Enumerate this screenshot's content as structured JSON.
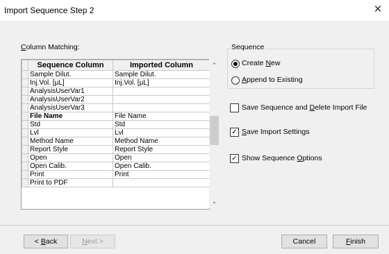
{
  "window": {
    "title": "Import Sequence Step 2",
    "close_glyph": "✕"
  },
  "column_matching": {
    "label": "Column Matching:",
    "headers": [
      "Sequence Column",
      "Imported Column"
    ],
    "rows": [
      {
        "seq": "Sample Dilut.",
        "imp": "Sample Dilut.",
        "bold": false
      },
      {
        "seq": "Inj.Vol. [µL]",
        "imp": "Inj.Vol. [µL]",
        "bold": false
      },
      {
        "seq": "AnalysisUserVar1",
        "imp": "",
        "bold": false
      },
      {
        "seq": "AnalysisUserVar2",
        "imp": "",
        "bold": false
      },
      {
        "seq": "AnalysisUserVar3",
        "imp": "",
        "bold": false
      },
      {
        "seq": "File Name",
        "imp": "File Name",
        "bold": true
      },
      {
        "seq": "Std",
        "imp": "Std",
        "bold": false
      },
      {
        "seq": "Lvl",
        "imp": "Lvl",
        "bold": false
      },
      {
        "seq": "Method Name",
        "imp": "Method Name",
        "bold": false
      },
      {
        "seq": "Report Style",
        "imp": "Report Style",
        "bold": false
      },
      {
        "seq": "Open",
        "imp": "Open",
        "bold": false
      },
      {
        "seq": "Open Calib.",
        "imp": "Open Calib.",
        "bold": false
      },
      {
        "seq": "Print",
        "imp": "Print",
        "bold": false
      },
      {
        "seq": "Print to PDF",
        "imp": "",
        "bold": false
      }
    ]
  },
  "sequence_group": {
    "label": "Sequence",
    "create_new": {
      "label": "Create New",
      "selected": true
    },
    "append_existing": {
      "label": "Append to Existing",
      "selected": false
    }
  },
  "options": {
    "save_and_delete": {
      "label": "Save Sequence and Delete Import File",
      "checked": false
    },
    "save_import_settings": {
      "label": "Save Import Settings",
      "checked": true
    },
    "show_sequence_options": {
      "label": "Show Sequence Options",
      "checked": true
    }
  },
  "buttons": {
    "back": "< Back",
    "next": "Next >",
    "cancel": "Cancel",
    "finish": "Finish"
  }
}
